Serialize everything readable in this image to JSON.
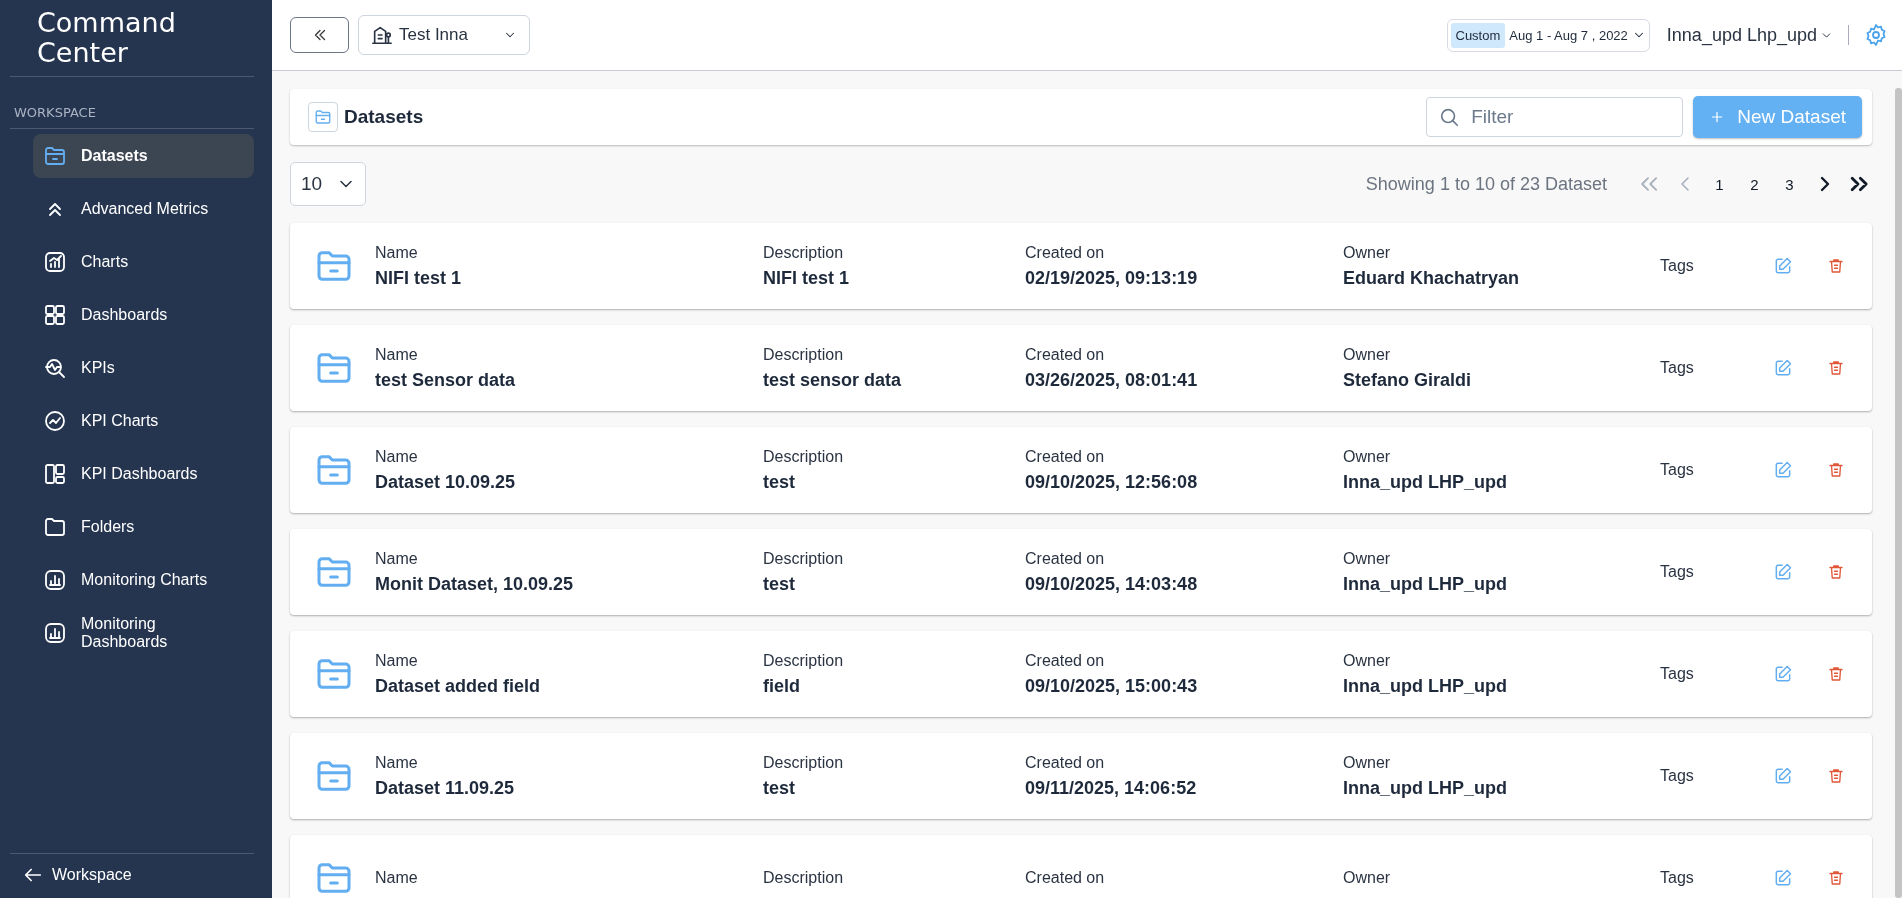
{
  "sidebar": {
    "title": "Command Center",
    "section": "WORKSPACE",
    "items": [
      {
        "label": "Datasets",
        "selected": true
      },
      {
        "label": "Advanced Metrics",
        "selected": false
      },
      {
        "label": "Charts",
        "selected": false
      },
      {
        "label": "Dashboards",
        "selected": false
      },
      {
        "label": "KPIs",
        "selected": false
      },
      {
        "label": "KPI Charts",
        "selected": false
      },
      {
        "label": "KPI Dashboards",
        "selected": false
      },
      {
        "label": "Folders",
        "selected": false
      },
      {
        "label": "Monitoring Charts",
        "selected": false
      },
      {
        "label": "Monitoring Dashboards",
        "selected": false
      }
    ],
    "footer": "Workspace"
  },
  "header": {
    "project": "Test Inna",
    "date_preset": "Custom",
    "date_range": "Aug 1 - Aug 7 , 2022",
    "user": "Inna_upd Lhp_upd"
  },
  "page": {
    "title": "Datasets",
    "filter_placeholder": "Filter",
    "new_button": "New Dataset"
  },
  "pagination": {
    "page_size": "10",
    "summary": "Showing 1 to 10 of 23 Dataset",
    "nav": [
      {
        "kind": "first",
        "disabled": true
      },
      {
        "kind": "prev",
        "disabled": true
      },
      {
        "kind": "page",
        "label": "1"
      },
      {
        "kind": "page",
        "label": "2"
      },
      {
        "kind": "page",
        "label": "3"
      },
      {
        "kind": "next",
        "disabled": false
      },
      {
        "kind": "last",
        "disabled": false
      }
    ]
  },
  "rows": [
    {
      "fields": [
        {
          "label": "Name",
          "value": "NIFI test 1"
        },
        {
          "label": "Description",
          "value": "NIFI test 1"
        },
        {
          "label": "Created on",
          "value": "02/19/2025, 09:13:19"
        },
        {
          "label": "Owner",
          "value": "Eduard Khachatryan"
        }
      ],
      "tags": "Tags"
    },
    {
      "fields": [
        {
          "label": "Name",
          "value": "test Sensor data"
        },
        {
          "label": "Description",
          "value": "test sensor data"
        },
        {
          "label": "Created on",
          "value": "03/26/2025, 08:01:41"
        },
        {
          "label": "Owner",
          "value": "Stefano Giraldi"
        }
      ],
      "tags": "Tags"
    },
    {
      "fields": [
        {
          "label": "Name",
          "value": "Dataset 10.09.25"
        },
        {
          "label": "Description",
          "value": "test"
        },
        {
          "label": "Created on",
          "value": "09/10/2025, 12:56:08"
        },
        {
          "label": "Owner",
          "value": "Inna_upd LHP_upd"
        }
      ],
      "tags": "Tags"
    },
    {
      "fields": [
        {
          "label": "Name",
          "value": "Monit Dataset, 10.09.25"
        },
        {
          "label": "Description",
          "value": "test"
        },
        {
          "label": "Created on",
          "value": "09/10/2025, 14:03:48"
        },
        {
          "label": "Owner",
          "value": "Inna_upd LHP_upd"
        }
      ],
      "tags": "Tags"
    },
    {
      "fields": [
        {
          "label": "Name",
          "value": "Dataset added field"
        },
        {
          "label": "Description",
          "value": "field"
        },
        {
          "label": "Created on",
          "value": "09/10/2025, 15:00:43"
        },
        {
          "label": "Owner",
          "value": "Inna_upd LHP_upd"
        }
      ],
      "tags": "Tags"
    },
    {
      "fields": [
        {
          "label": "Name",
          "value": "Dataset 11.09.25"
        },
        {
          "label": "Description",
          "value": "test"
        },
        {
          "label": "Created on",
          "value": "09/11/2025, 14:06:52"
        },
        {
          "label": "Owner",
          "value": "Inna_upd LHP_upd"
        }
      ],
      "tags": "Tags"
    },
    {
      "fields": [
        {
          "label": "Name"
        },
        {
          "label": "Description"
        },
        {
          "label": "Created on"
        },
        {
          "label": "Owner"
        }
      ],
      "tags": "Tags"
    }
  ]
}
